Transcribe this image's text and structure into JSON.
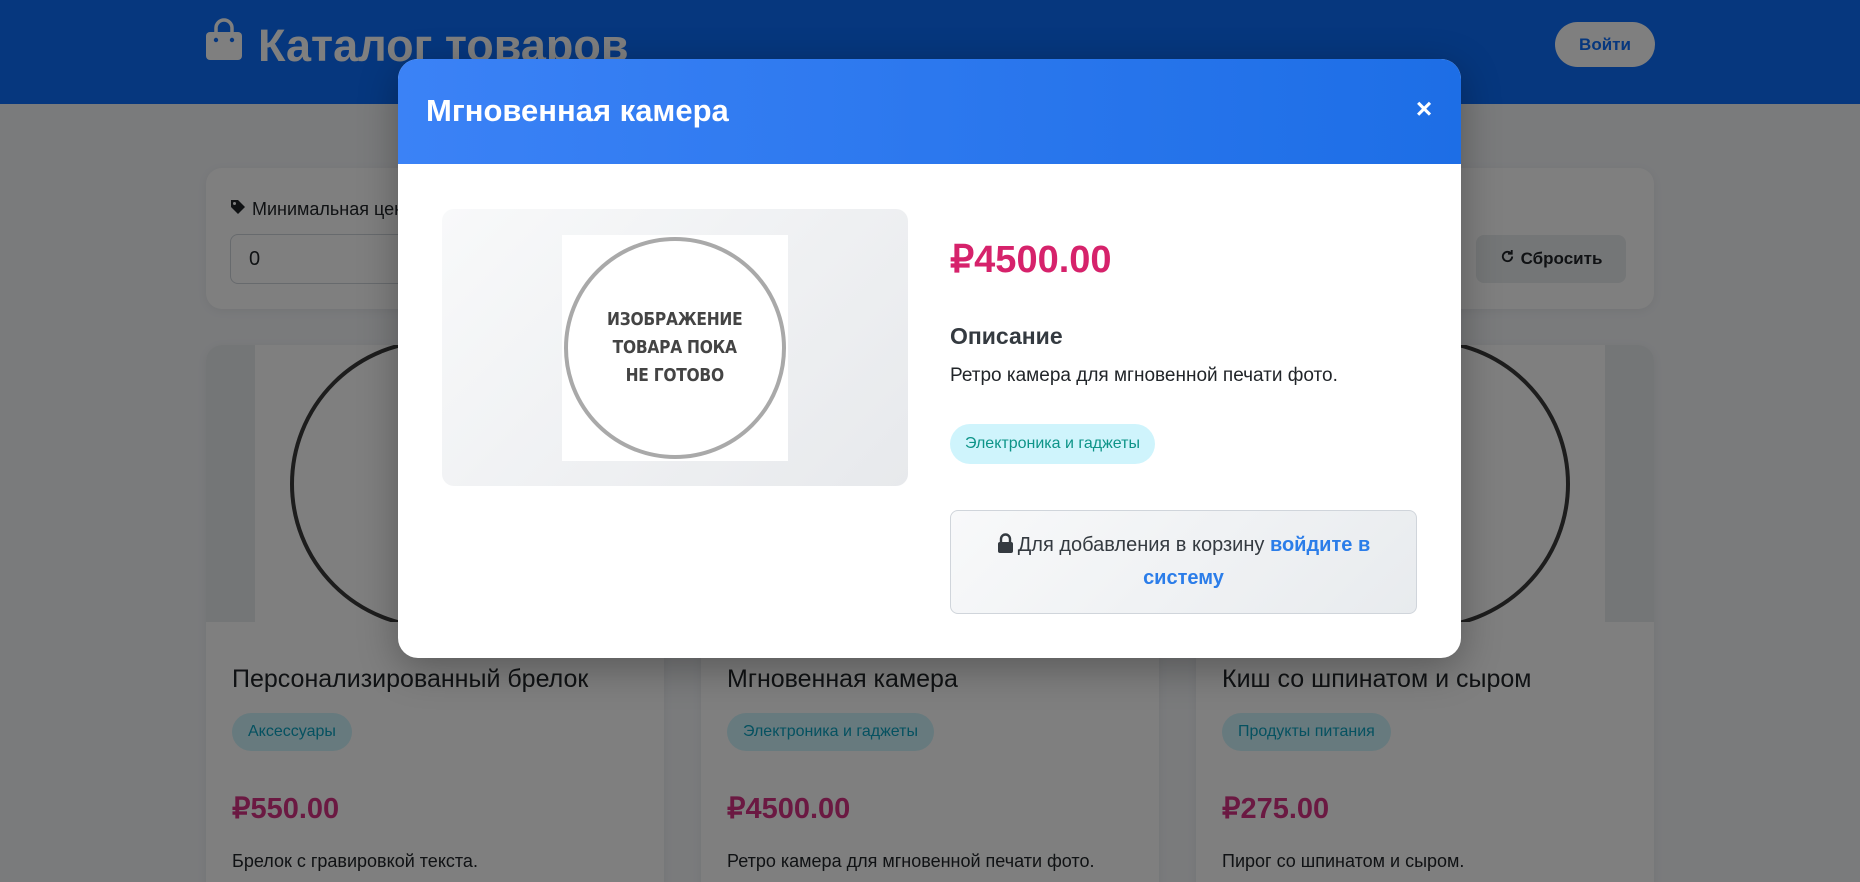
{
  "header": {
    "title": "Каталог товаров",
    "icon": "shopping-bag-icon",
    "login_label": "Войти"
  },
  "filters": {
    "min_price_label": "Минимальная цена",
    "min_price_value": "0",
    "reset_label": "Сбросить"
  },
  "products": [
    {
      "name": "Персонализированный брелок",
      "category": "Аксессуары",
      "price": "₽550.00",
      "description": "Брелок с гравировкой текста."
    },
    {
      "name": "Мгновенная камера",
      "category": "Электроника и гаджеты",
      "price": "₽4500.00",
      "description": "Ретро камера для мгновенной печати фото."
    },
    {
      "name": "Киш со шпинатом и сыром",
      "category": "Продукты питания",
      "price": "₽275.00",
      "description": "Пирог со шпинатом и сыром."
    }
  ],
  "modal": {
    "title": "Мгновенная камера",
    "close_label": "×",
    "image_placeholder_lines": [
      "ИЗОБРАЖЕНИЕ",
      "ТОВАРА ПОКА",
      "НЕ ГОТОВО"
    ],
    "price": "₽4500.00",
    "description_title": "Описание",
    "description": "Ретро камера для мгновенной печати фото.",
    "category": "Электроника и гаджеты",
    "login_prompt": "Для добавления в корзину",
    "login_link": "войдите в систему"
  },
  "colors": {
    "primary": "#0d6efd",
    "price": "#d6226b",
    "badge_bg": "#cff4fc",
    "badge_text": "#0d9488"
  }
}
